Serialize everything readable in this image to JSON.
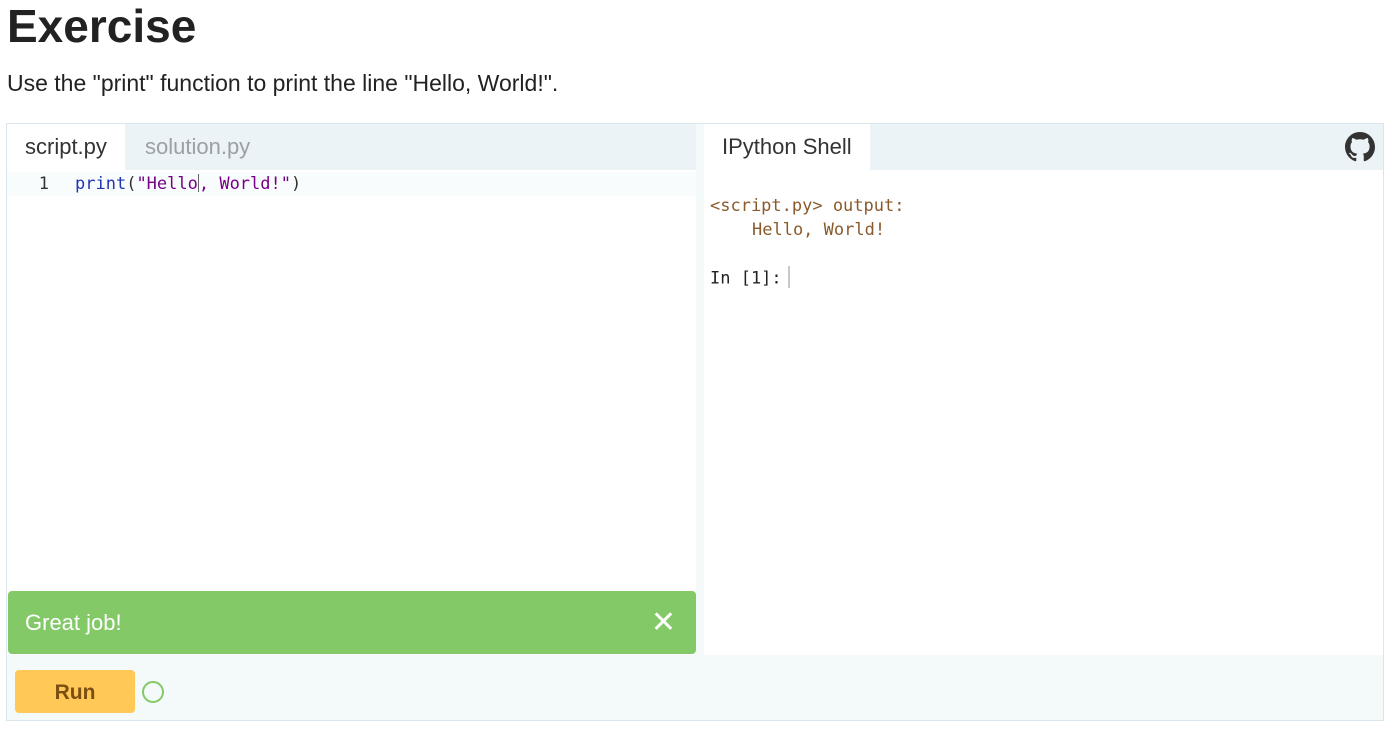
{
  "page": {
    "title": "Exercise",
    "instructions": "Use the \"print\" function to print the line \"Hello, World!\"."
  },
  "editor": {
    "tabs": [
      {
        "label": "script.py",
        "active": true
      },
      {
        "label": "solution.py",
        "active": false
      }
    ],
    "lines": [
      {
        "number": "1",
        "tokens": {
          "func": "print",
          "open_paren": "(",
          "string_a": "\"Hello",
          "string_b": ", World!\"",
          "close_paren": ")"
        }
      }
    ]
  },
  "feedback": {
    "message": "Great job!",
    "close_glyph": "✕",
    "color": "#83c968"
  },
  "shell": {
    "tab_label": "IPython Shell",
    "output_header": "<script.py> output:",
    "output_lines": [
      "Hello, World!"
    ],
    "prompt": "In [1]:",
    "github_icon": "github-icon"
  },
  "actions": {
    "run_label": "Run",
    "run_color": "#ffc857",
    "status_icon": "circle-outline-icon"
  }
}
